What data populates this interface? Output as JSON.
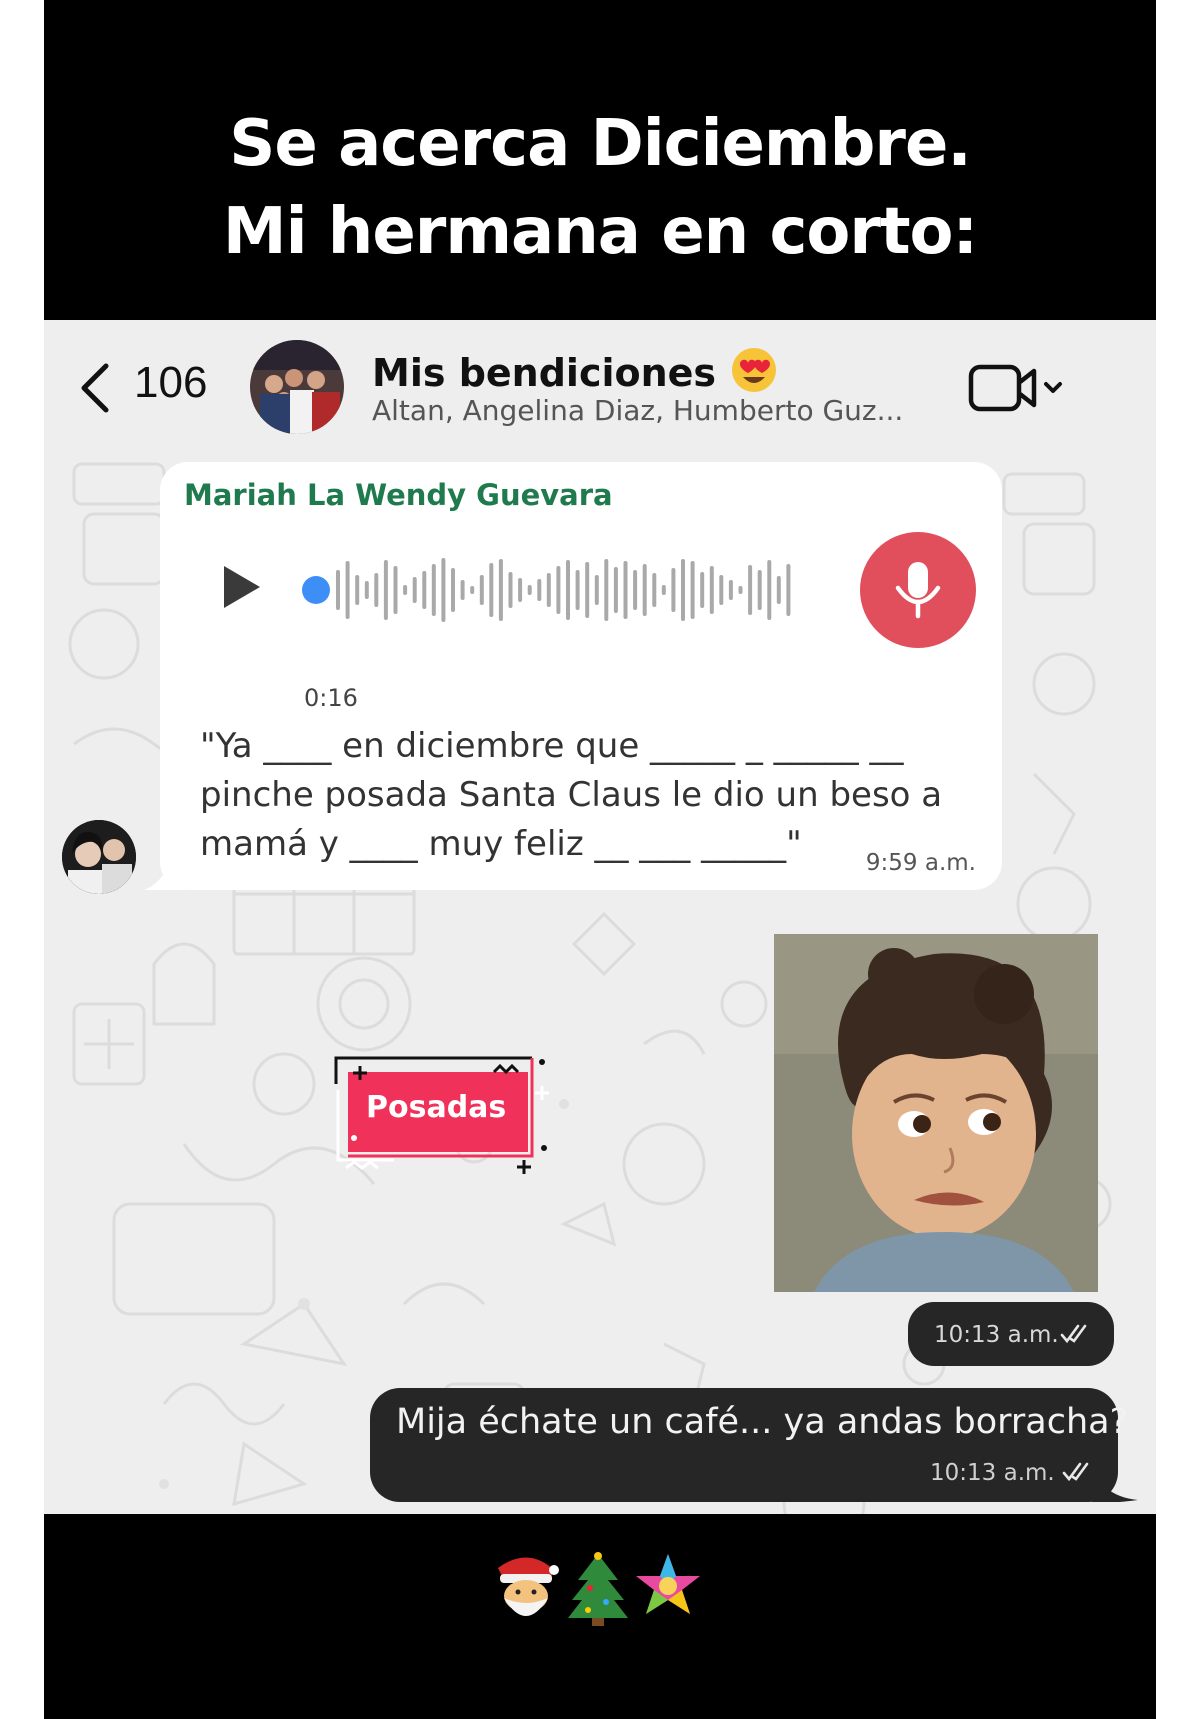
{
  "caption": {
    "line1": "Se acerca Diciembre.",
    "line2": "Mi hermana en corto:"
  },
  "header": {
    "back_count": "106",
    "title": "Mis bendiciones",
    "title_emoji": "heart-eyes-emoji-icon",
    "subtitle": "Altan, Angelina Diaz, Humberto Guz...",
    "video_icon": "video-call-icon"
  },
  "voice_message": {
    "sender": "Mariah La Wendy Guevara",
    "duration": "0:16",
    "transcript": "\"Ya ____ en diciembre que _____ _ _____ __\npinche posada Santa Claus le dio un beso a\nmamá y ____ muy feliz __ ___ _____\"",
    "time": "9:59 a.m.",
    "progress": 0,
    "mic_color": "#e04f5b",
    "dot_color": "#3e8ef7"
  },
  "sticker": {
    "label": "Posadas",
    "color": "#f0325a"
  },
  "image_message": {
    "time": "10:13 a.m."
  },
  "text_message": {
    "text": "Mija échate un café... ya andas borracha?",
    "time": "10:13 a.m."
  },
  "colors": {
    "sender_name": "#1f7a4d",
    "outgoing_bubble": "#262626",
    "chat_background": "#eeeeee"
  },
  "footer_emojis": [
    "santa-emoji-icon",
    "christmas-tree-emoji-icon",
    "pinata-emoji-icon"
  ]
}
